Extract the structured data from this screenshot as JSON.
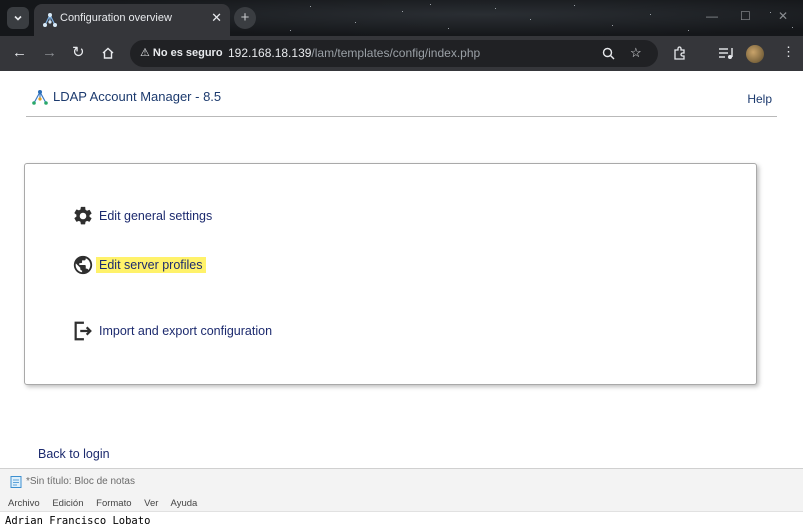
{
  "browser": {
    "tab_title": "Configuration overview",
    "tab_close": "✕",
    "new_tab": "+",
    "security_label": "No es seguro",
    "url_host": "192.168.18.139",
    "url_path": "/lam/templates/config/index.php"
  },
  "app": {
    "title": "LDAP Account Manager - 8.5",
    "help": "Help"
  },
  "menu": {
    "general_settings": "Edit general settings",
    "server_profiles": "Edit server profiles",
    "import_export": "Import and export configuration"
  },
  "back_link": "Back to login",
  "notepad": {
    "title": "*Sin título: Bloc de notas",
    "menu": [
      "Archivo",
      "Edición",
      "Formato",
      "Ver",
      "Ayuda"
    ],
    "content": "Adrian Francisco Lobato"
  },
  "colors": {
    "link": "#1c2a6e",
    "highlight": "#fff26a",
    "chrome_dark": "#35363a"
  }
}
